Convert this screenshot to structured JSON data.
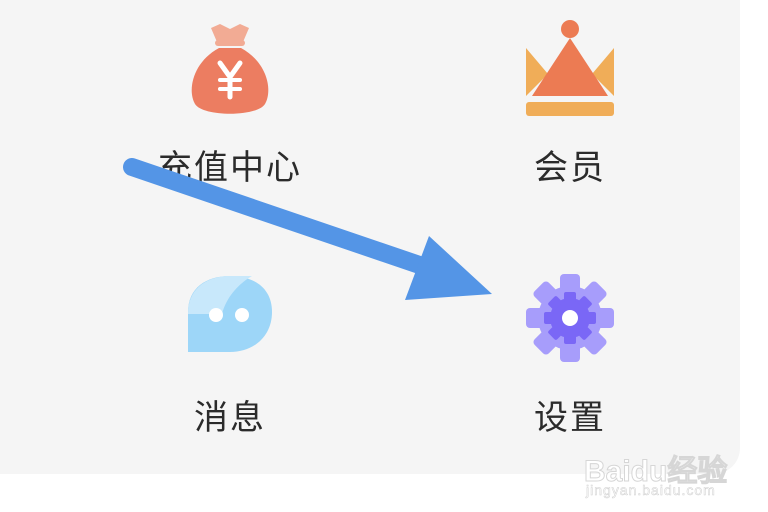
{
  "menu": {
    "items": [
      {
        "label": "充值中心",
        "icon": "money-bag-icon"
      },
      {
        "label": "会员",
        "icon": "crown-icon"
      },
      {
        "label": "消息",
        "icon": "chat-bubble-icon"
      },
      {
        "label": "设置",
        "icon": "gear-icon"
      }
    ]
  },
  "colors": {
    "panel_bg": "#f5f5f5",
    "money_bag": "#ec7d61",
    "crown_top": "#ec7b53",
    "crown_side": "#f0ad58",
    "chat_bubble": "#9dd6f8",
    "gear": "#a79dfb",
    "gear_inner": "#7a67f6",
    "arrow": "#5495e6",
    "label_text": "#2b2b2b"
  },
  "watermark": {
    "brand": "Baidu经验",
    "url": "jingyan.baidu.com"
  }
}
